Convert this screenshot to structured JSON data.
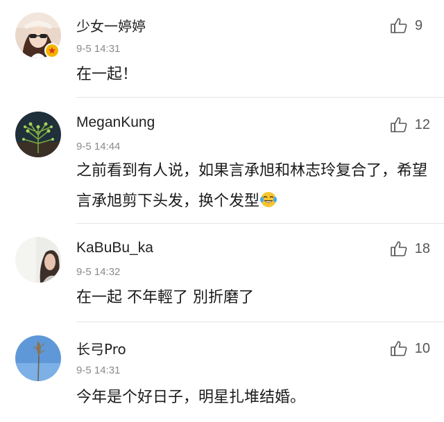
{
  "comments": [
    {
      "username": "少女一婷婷",
      "time": "9-5 14:31",
      "likes": "9",
      "text": "在一起！",
      "avatar": "woman-sunglasses-avatar",
      "verified_badge": "orange-star-badge"
    },
    {
      "username": "MeganKung",
      "time": "9-5 14:44",
      "likes": "12",
      "text": "之前看到有人说，如果言承旭和林志玲复合了，希望言承旭剪下头发，换个发型",
      "emoji": "laughing-tears-emoji",
      "avatar": "plant-avatar"
    },
    {
      "username": "KaBuBu_ka",
      "time": "9-5 14:32",
      "likes": "18",
      "text": "在一起 不年輕了 別折磨了",
      "avatar": "girl-photo-avatar"
    },
    {
      "username": "长弓Pro",
      "time": "9-5 14:31",
      "likes": "10",
      "text": "今年是个好日子，明星扎堆结婚。",
      "avatar": "reed-sky-avatar"
    }
  ],
  "colors": {
    "text": "#1a1a1a",
    "meta": "#8a8a8a",
    "divider": "#e3e3e3",
    "badge": "#f5b400"
  }
}
